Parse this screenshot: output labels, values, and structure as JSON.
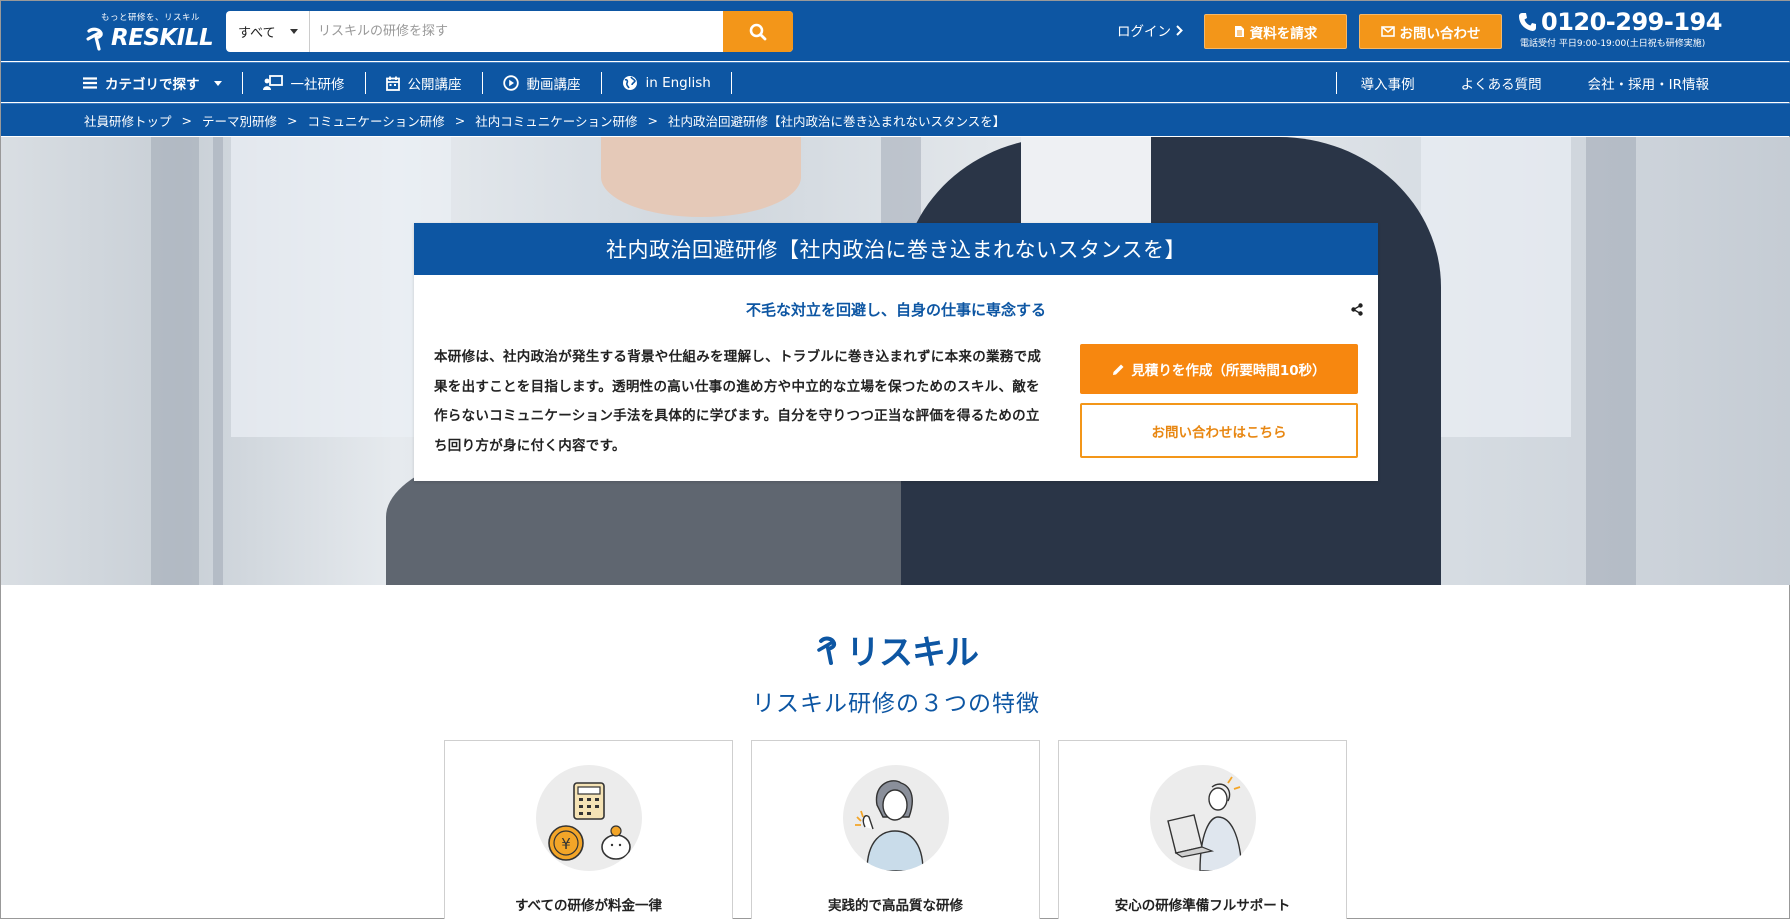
{
  "header": {
    "logo_tagline": "もっと研修を、リスキル",
    "logo_word": "RESKILL",
    "search_scope": "すべて",
    "search_placeholder": "リスキルの研修を探す",
    "login": "ログイン",
    "request_docs": "資料を請求",
    "contact": "お問い合わせ",
    "phone_number": "0120-299-194",
    "phone_hours": "電話受付 平日9:00-19:00(土日祝も研修実施)"
  },
  "nav": {
    "left": [
      {
        "label": "カテゴリで探す",
        "icon": "menu-icon"
      },
      {
        "label": "一社研修",
        "icon": "presentation-icon"
      },
      {
        "label": "公開講座",
        "icon": "calendar-icon"
      },
      {
        "label": "動画講座",
        "icon": "play-icon"
      },
      {
        "label": "in English",
        "icon": "globe-icon"
      }
    ],
    "right": [
      "導入事例",
      "よくある質問",
      "会社・採用・IR情報"
    ]
  },
  "breadcrumb": [
    "社員研修トップ",
    "テーマ別研修",
    "コミュニケーション研修",
    "社内コミュニケーション研修",
    "社内政治回避研修【社内政治に巻き込まれないスタンスを】"
  ],
  "breadcrumb_sep": ">",
  "course": {
    "title": "社内政治回避研修【社内政治に巻き込まれないスタンスを】",
    "subtitle": "不毛な対立を回避し、自身の仕事に専念する",
    "description": "本研修は、社内政治が発生する背景や仕組みを理解し、トラブルに巻き込まれずに本来の業務で成果を出すことを目指します。透明性の高い仕事の進め方や中立的な立場を保つためのスキル、敵を作らないコミュニケーション手法を具体的に学びます。自分を守りつつ正当な評価を得るための立ち回り方が身に付く内容です。",
    "quote_button": "見積りを作成（所要時間10秒）",
    "inquiry_button": "お問い合わせはこちら"
  },
  "features": {
    "brand": "リスキル",
    "title": "リスキル研修の３つの特徴",
    "items": [
      {
        "label": "すべての研修が料金一律"
      },
      {
        "label": "実践的で高品質な研修"
      },
      {
        "label": "安心の研修準備フルサポート"
      }
    ]
  },
  "colors": {
    "brand_blue": "#0d56a3",
    "accent_orange": "#f39619"
  }
}
